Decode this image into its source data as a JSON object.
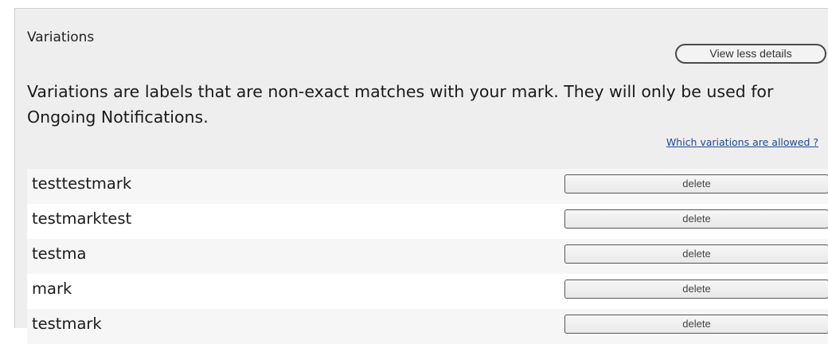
{
  "section": {
    "title": "Variations",
    "view_less_label": "View less details",
    "description": "Variations are labels that are non-exact matches with your mark. They will only be used for Ongoing Notifications.",
    "help_link": "Which variations are allowed ?"
  },
  "variations": [
    {
      "label": "testtestmark",
      "delete_label": "delete"
    },
    {
      "label": "testmarktest",
      "delete_label": "delete"
    },
    {
      "label": "testma",
      "delete_label": "delete"
    },
    {
      "label": "mark",
      "delete_label": "delete"
    },
    {
      "label": "testmark",
      "delete_label": "delete"
    }
  ]
}
